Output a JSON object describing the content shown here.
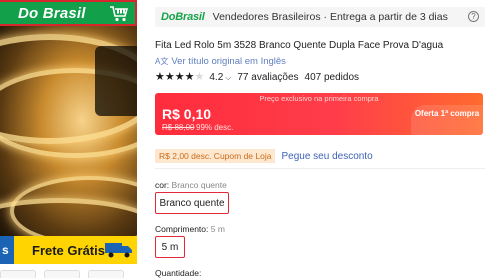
{
  "gallery": {
    "promo_banner": "Do Brasil",
    "shipping_edge": "s",
    "shipping_banner": "Frete Grátis"
  },
  "seller_bar": {
    "logo": "DoBrasil",
    "description": "Vendedores Brasileiros · Entrega a partir de 3 dias",
    "help": "?"
  },
  "product": {
    "title": "Fita Led Rolo 5m 3528 Branco Quente Dupla Face Prova D'agua",
    "translate_link": "Ver título original em Inglês",
    "rating": {
      "value": 4.2,
      "score_text": "4.2",
      "chevron": "⌵",
      "reviews": "77 avaliações",
      "orders": "407 pedidos"
    }
  },
  "price": {
    "hint": "Preço exclusivo na primeira compra",
    "current": "R$ 0,10",
    "original": "R$ 88,00",
    "discount": "99% desc.",
    "offer": "Oferta 1ª compra",
    "accent_color": "#ff2c3c"
  },
  "coupon": {
    "badge": "R$ 2,00 desc. Cupom de Loja",
    "link": "Pegue seu desconto"
  },
  "options": {
    "color_label": "cor:",
    "color_value": "Branco quente",
    "color_selected": "Branco quente",
    "length_label": "Comprimento:",
    "length_value": "5 m",
    "length_selected": "5 m",
    "quantity_label": "Quantidade:"
  }
}
